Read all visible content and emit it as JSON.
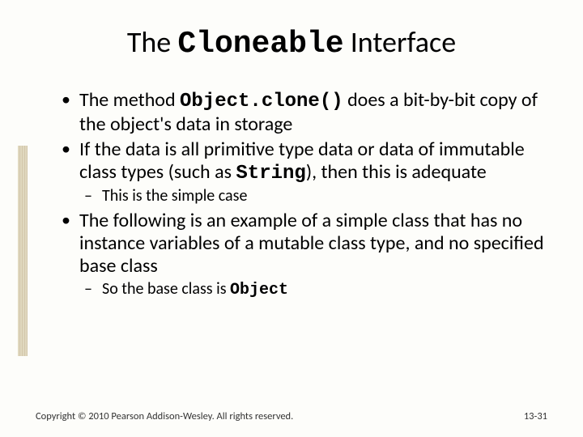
{
  "title": {
    "prefix": "The ",
    "code": "Cloneable",
    "suffix": " Interface"
  },
  "bullets": {
    "b1": {
      "t1": "The method ",
      "code": "Object.clone()",
      "t2": " does a bit-by-bit copy of the object's data in storage"
    },
    "b2": {
      "t1": "If the data is all primitive type data or data of immutable class types (such as ",
      "code": "String",
      "t2": "), then this is adequate"
    },
    "b2sub": "This is the simple case",
    "b3": "The following is an example of a simple class that has no instance variables of a mutable class type, and no specified base class",
    "b3sub": {
      "t1": "So the base class is ",
      "code": "Object"
    }
  },
  "footer": {
    "copyright": "Copyright © 2010 Pearson Addison-Wesley. All rights reserved.",
    "page": "13-31"
  }
}
